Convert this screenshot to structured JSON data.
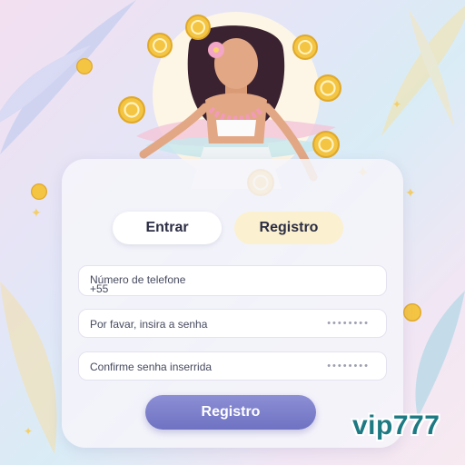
{
  "tabs": {
    "login": "Entrar",
    "register": "Registro"
  },
  "form": {
    "phone_label": "Número de telefone",
    "phone_prefix": "+55",
    "password_placeholder": "Por favar, insira a senha",
    "password_mask": "••••••••",
    "confirm_placeholder": "Confirme senha inserrida",
    "confirm_mask": "••••••••"
  },
  "submit_label": "Registro",
  "brand": "vip777",
  "colors": {
    "accent": "#7a7dca",
    "tab_active": "#fbf0cf",
    "brand_text": "#1d7a83",
    "coin": "#f4c542"
  }
}
